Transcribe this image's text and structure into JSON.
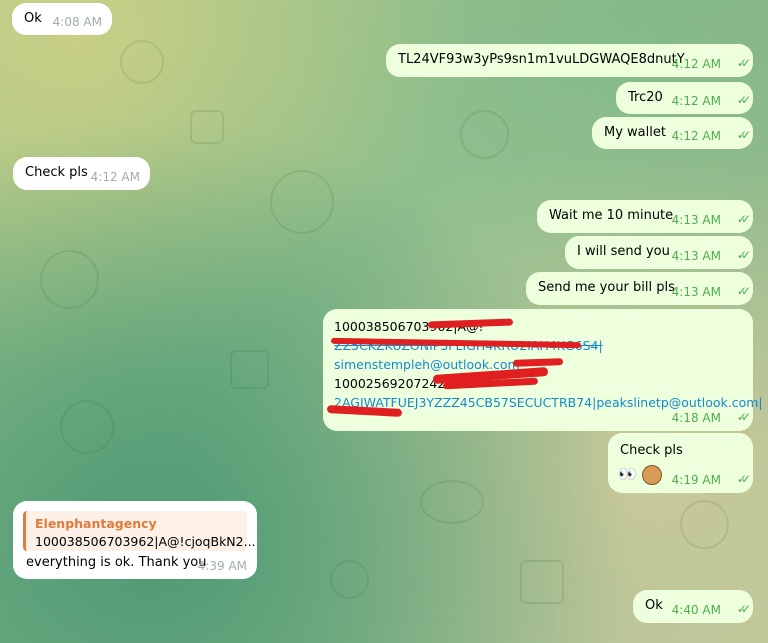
{
  "messages": [
    {
      "side": "in",
      "text": "Ok",
      "time": "4:08 AM"
    },
    {
      "side": "out",
      "text": "TL24VF93w3yPs9sn1m1vuLDGWAQE8dnutY",
      "time": "4:12 AM"
    },
    {
      "side": "out",
      "text": "Trc20",
      "time": "4:12 AM"
    },
    {
      "side": "out",
      "text": "My wallet",
      "time": "4:12 AM"
    },
    {
      "side": "in",
      "text": "Check pls",
      "time": "4:12 AM"
    },
    {
      "side": "out",
      "text": "Wait me 10 minute",
      "time": "4:13 AM"
    },
    {
      "side": "out",
      "text": "I will send you",
      "time": "4:13 AM"
    },
    {
      "side": "out",
      "text": "Send me your bill pls",
      "time": "4:13 AM"
    },
    {
      "side": "out",
      "time": "4:18 AM",
      "lines": [
        "100038506703962|A@!",
        "ZZ5CKZKUZONIP5FLIGH4KRU2IAH4KG6S4|",
        "simenstempleh@outlook.com",
        "100025692072421",
        "2AGIWATFUEJ3YZZZ45CB57SECUCTRB74|peakslinetp@outlook.com|"
      ]
    },
    {
      "side": "out",
      "text": "Check pls",
      "emoji": "👀",
      "time": "4:19 AM"
    },
    {
      "side": "in",
      "reply": {
        "name": "Elenphantagency",
        "text": "100038506703962|A@!cjoqBkN2..."
      },
      "text": "everything is ok. Thank you",
      "time": "4:39 AM"
    },
    {
      "side": "out",
      "text": "Ok",
      "time": "4:40 AM"
    }
  ],
  "colors": {
    "incoming": "#ffffff",
    "outgoing": "#eeffde",
    "time_out": "#4fae4e",
    "link": "#168acd",
    "reply_accent": "#e17a3b"
  },
  "icons": {
    "read": "double-check-icon",
    "reaction": "eyes-emoji",
    "avatar": "user-avatar"
  }
}
